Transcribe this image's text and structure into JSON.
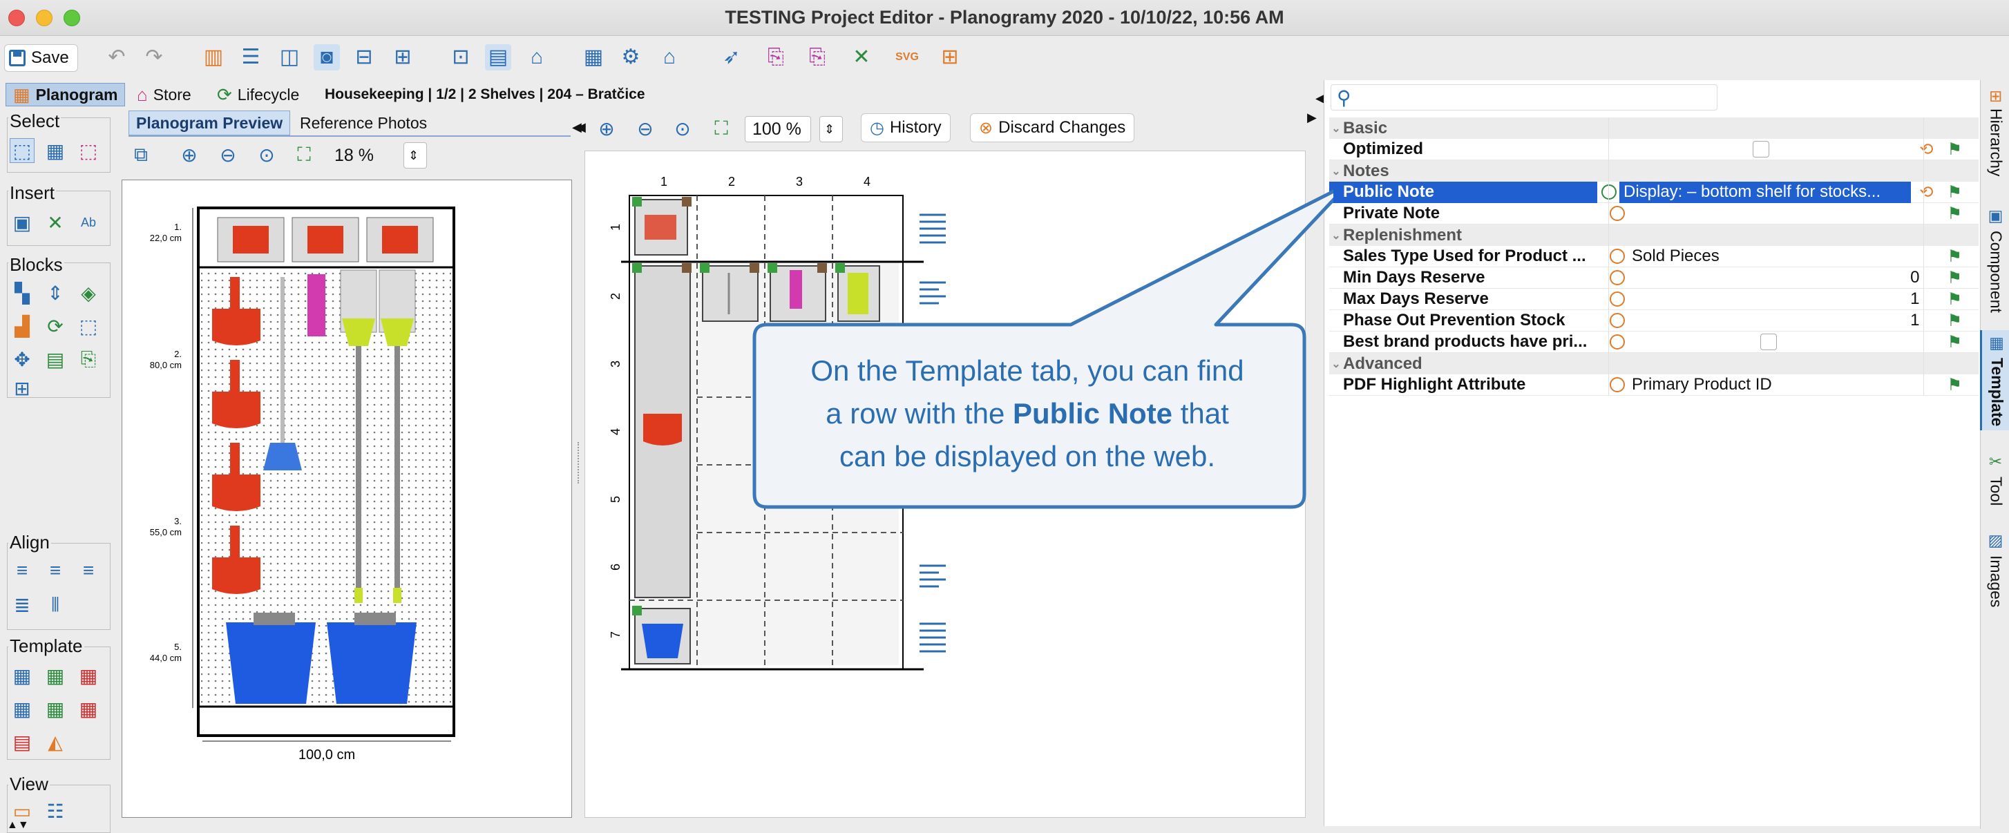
{
  "window": {
    "title": "TESTING Project Editor - Planogramy 2020 - 10/10/22, 10:56 AM"
  },
  "toolbar": {
    "save_label": "Save"
  },
  "nav": {
    "planogram": "Planogram",
    "store": "Store",
    "lifecycle": "Lifecycle",
    "breadcrumb": "Housekeeping  |  1/2  |  2 Shelves  |  204 – Bratčice"
  },
  "palette": {
    "select": "Select",
    "insert": "Insert",
    "blocks": "Blocks",
    "align": "Align",
    "template": "Template",
    "view": "View"
  },
  "preview": {
    "tab_preview": "Planogram Preview",
    "tab_photos": "Reference Photos",
    "zoom": "18 %",
    "shelf_labels": [
      "1.",
      "22,0 cm",
      "2.",
      "80,0 cm",
      "3.",
      "55,0 cm",
      "5.",
      "44,0 cm"
    ],
    "width_label": "100,0 cm"
  },
  "grid": {
    "zoom": "100 %",
    "history": "History",
    "discard": "Discard Changes",
    "columns": [
      "1",
      "2",
      "3",
      "4"
    ],
    "rows": [
      "1",
      "2",
      "3",
      "4",
      "5",
      "6",
      "7"
    ]
  },
  "properties": {
    "search_placeholder": "",
    "categories": {
      "basic": "Basic",
      "notes": "Notes",
      "replenishment": "Replenishment",
      "advanced": "Advanced"
    },
    "rows": {
      "optimized": "Optimized",
      "public_note": "Public Note",
      "public_note_value": "Display: – bottom shelf for stocks...",
      "private_note": "Private Note",
      "sales_type": "Sales Type Used for Product ...",
      "sales_type_value": "Sold Pieces",
      "min_days": "Min Days Reserve",
      "min_days_value": "0",
      "max_days": "Max Days Reserve",
      "max_days_value": "1",
      "phase_out": "Phase Out Prevention Stock",
      "phase_out_value": "1",
      "best_brand": "Best brand products have pri...",
      "pdf_attr": "PDF Highlight Attribute",
      "pdf_attr_value": "Primary Product ID"
    }
  },
  "sidetabs": {
    "hierarchy": "Hierarchy",
    "component": "Component",
    "template": "Template",
    "tool": "Tool",
    "images": "Images"
  },
  "callout": {
    "line1": "On the Template tab, you can find",
    "line2_pre": "a row with the",
    "line2_bold": "Public Note",
    "line2_post": "that",
    "line3": "can be displayed on the web."
  },
  "colors": {
    "accent": "#2a6db0",
    "selection": "#1f5fd0",
    "callout_fill": "#f0f4f9",
    "callout_border": "#3a78b8",
    "product_red": "#e03a1e",
    "product_blue": "#1f5be0"
  }
}
